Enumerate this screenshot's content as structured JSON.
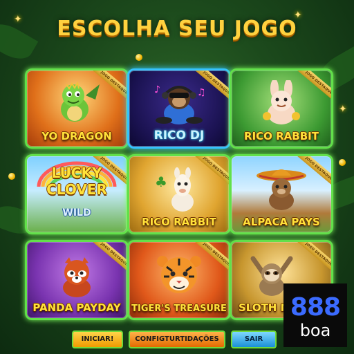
{
  "screen": {
    "title": "ESCOLHA SEU JOGO"
  },
  "games": [
    {
      "label": "YO DRAGON",
      "ribbon": "JOGO DESTAQUE",
      "theme": "orange",
      "icon": "dragon-icon"
    },
    {
      "label": "RICO DJ",
      "ribbon": "JOGO DESTAQUE",
      "theme": "neon-blue",
      "icon": "monkey-dj-icon"
    },
    {
      "label": "RICO RABBIT",
      "ribbon": "JOGO DESTAQUE",
      "theme": "green",
      "icon": "rabbit-icon"
    },
    {
      "label": "LUCKY CLOVER",
      "sublabel": "WILD",
      "ribbon": "JOGO DESTAQUE",
      "theme": "rainbow",
      "icon": "clover-logo-icon"
    },
    {
      "label": "RICO RABBIT",
      "ribbon": "JOGO DESTAQUE",
      "theme": "gold",
      "icon": "alpaca-icon"
    },
    {
      "label": "ALPACA PAYS",
      "ribbon": "JOGO DESTAQUE",
      "theme": "sky",
      "icon": "bear-sombrero-icon"
    },
    {
      "label": "PANDA PAYDAY",
      "ribbon": "JOGO DESTAQUE",
      "theme": "purple",
      "icon": "red-panda-icon"
    },
    {
      "label": "TIGER'S TREASURE",
      "ribbon": "JOGO DESTAQUE",
      "theme": "orange-red",
      "icon": "tiger-icon"
    },
    {
      "label": "SLOTH M",
      "ribbon": "JOGO DESTAQUE",
      "theme": "jungle",
      "icon": "sloth-icon"
    }
  ],
  "buttons": {
    "start": "INICIAR!",
    "settings": "CONFIGTURTIDAÇÕES",
    "exit": "SAIR"
  },
  "brand": {
    "number": "888",
    "name": "boa"
  },
  "colors": {
    "title": "#ffd23f",
    "tile_border": "#62e04a",
    "tile_border_dj": "#35c3ff",
    "brand_blue": "#3b6bff"
  }
}
